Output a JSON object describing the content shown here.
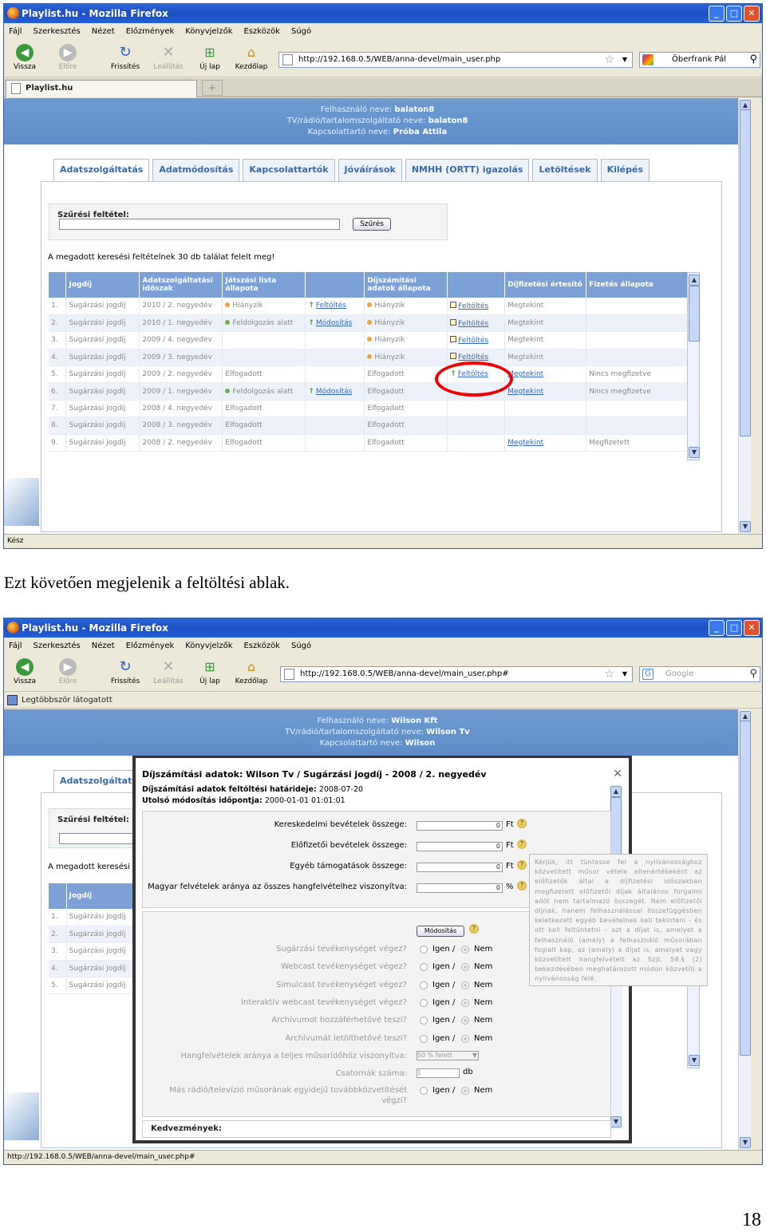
{
  "browser": {
    "window_title": "Playlist.hu - Mozilla Firefox",
    "menu": [
      "Fájl",
      "Szerkesztés",
      "Nézet",
      "Előzmények",
      "Könyvjelzők",
      "Eszközök",
      "Súgó"
    ],
    "toolbar": {
      "back": "Vissza",
      "forward": "Előre",
      "reload": "Frissítés",
      "stop": "Leállítás",
      "newtab": "Új lap",
      "home": "Kezdőlap"
    }
  },
  "shot1": {
    "url": "http://192.168.0.5/WEB/anna-devel/main_user.php",
    "search_value": "Öberfrank Pál",
    "tab_title": "Playlist.hu",
    "header": {
      "user_label": "Felhasználó neve:",
      "user": "balaton8",
      "provider_label": "TV/rádió/tartalomszolgáltató neve:",
      "provider": "balaton8",
      "contact_label": "Kapcsolattartó neve:",
      "contact": "Próba Attila"
    },
    "tabs": [
      "Adatszolgáltatás",
      "Adatmódosítás",
      "Kapcsolattartók",
      "Jóváírások",
      "NMHH (ORTT) igazolás",
      "Letöltések",
      "Kilépés"
    ],
    "filter_label": "Szűrési feltétel:",
    "filter_button": "Szűrés",
    "result_text": "A megadott keresési feltételnek 30 db találat felelt meg!",
    "columns": [
      "",
      "Jogdíj",
      "Adatszolgáltatási időszak",
      "Játszási lista állapota",
      "",
      "Díjszámítási adatok állapota",
      "",
      "Díjfizetési értesítő",
      "Fizetés állapota"
    ],
    "rows": [
      {
        "n": "1.",
        "fee": "Sugárzási jogdíj",
        "period": "2010 / 2. negyedév",
        "pl_state": "Hiányzik",
        "pl_dot": "o",
        "pl_action": "Feltöltés",
        "calc_state": "Hiányzik",
        "calc_dot": "o",
        "calc_action": "Feltöltés",
        "notice": "Megtekint",
        "notice_link": false,
        "pay": ""
      },
      {
        "n": "2.",
        "fee": "Sugárzási jogdíj",
        "period": "2010 / 1. negyedév",
        "pl_state": "Feldolgozás alatt",
        "pl_dot": "g",
        "pl_action": "Módosítás",
        "calc_state": "Hiányzik",
        "calc_dot": "o",
        "calc_action": "Feltöltés",
        "notice": "Megtekint",
        "notice_link": false,
        "pay": ""
      },
      {
        "n": "3.",
        "fee": "Sugárzási jogdíj",
        "period": "2009 / 4. negyedév",
        "pl_state": "",
        "pl_dot": "",
        "pl_action": "",
        "calc_state": "Hiányzik",
        "calc_dot": "o",
        "calc_action": "Feltöltés",
        "notice": "Megtekint",
        "notice_link": false,
        "pay": ""
      },
      {
        "n": "4.",
        "fee": "Sugárzási jogdíj",
        "period": "2009 / 3. negyedév",
        "pl_state": "",
        "pl_dot": "",
        "pl_action": "",
        "calc_state": "Hiányzik",
        "calc_dot": "o",
        "calc_action": "Feltöltés",
        "notice": "Megtekint",
        "notice_link": false,
        "pay": ""
      },
      {
        "n": "5.",
        "fee": "Sugárzási jogdíj",
        "period": "2009 / 2. negyedév",
        "pl_state": "Elfogadott",
        "pl_dot": "",
        "pl_action": "",
        "calc_state": "Elfogadott",
        "calc_dot": "",
        "calc_action": "Feltöltés",
        "notice": "Megtekint",
        "notice_link": true,
        "pay": "Nincs megfizetve"
      },
      {
        "n": "6.",
        "fee": "Sugárzási jogdíj",
        "period": "2009 / 1. negyedév",
        "pl_state": "Feldolgozás alatt",
        "pl_dot": "g",
        "pl_action": "Módosítás",
        "calc_state": "Elfogadott",
        "calc_dot": "",
        "calc_action": "",
        "notice": "Megtekint",
        "notice_link": true,
        "pay": "Nincs megfizetve"
      },
      {
        "n": "7.",
        "fee": "Sugárzási jogdíj",
        "period": "2008 / 4. negyedév",
        "pl_state": "Elfogadott",
        "pl_dot": "",
        "pl_action": "",
        "calc_state": "Elfogadott",
        "calc_dot": "",
        "calc_action": "",
        "notice": "",
        "notice_link": false,
        "pay": ""
      },
      {
        "n": "8.",
        "fee": "Sugárzási jogdíj",
        "period": "2008 / 3. negyedév",
        "pl_state": "Elfogadott",
        "pl_dot": "",
        "pl_action": "",
        "calc_state": "Elfogadott",
        "calc_dot": "",
        "calc_action": "",
        "notice": "",
        "notice_link": false,
        "pay": ""
      },
      {
        "n": "9.",
        "fee": "Sugárzási jogdíj",
        "period": "2008 / 2. negyedév",
        "pl_state": "Elfogadott",
        "pl_dot": "",
        "pl_action": "",
        "calc_state": "Elfogadott",
        "calc_dot": "",
        "calc_action": "",
        "notice": "Megtekint",
        "notice_link": true,
        "pay": "Megfizetett"
      }
    ],
    "status": "Kész"
  },
  "caption": "Ezt követően megjelenik a feltöltési ablak.",
  "shot2": {
    "url": "http://192.168.0.5/WEB/anna-devel/main_user.php#",
    "search_placeholder": "Google",
    "bookmark": "Legtöbbször látogatott",
    "header": {
      "user_label": "Felhasználó neve:",
      "user": "Wilson Kft",
      "provider_label": "TV/rádió/tartalomszolgáltató neve:",
      "provider": "Wilson Tv",
      "contact_label": "Kapcsolattartó neve:",
      "contact": "Wilson"
    },
    "bg_tab": "Adatszolgáltatás",
    "bg_filter_label": "Szűrési feltétel:",
    "bg_result": "A megadott keresési f",
    "bg_col": "Jogdíj",
    "bg_rows": [
      {
        "n": "1.",
        "fee": "Sugárzási jogdíj"
      },
      {
        "n": "2.",
        "fee": "Sugárzási jogdíj"
      },
      {
        "n": "3.",
        "fee": "Sugárzási jogdíj"
      },
      {
        "n": "4.",
        "fee": "Sugárzási jogdíj"
      },
      {
        "n": "5.",
        "fee": "Sugárzási jogdíj"
      }
    ],
    "modal": {
      "title": "Díjszámítási adatok: Wilson Tv / Sugárzási jogdíj - 2008 / 2. negyedév",
      "deadline_label": "Díjszámítási adatok feltöltési határideje:",
      "deadline": "2008-07-20",
      "modified_label": "Utolsó módosítás időpontja:",
      "modified": "2000-01-01 01:01:01",
      "fields": [
        {
          "label": "Kereskedelmi bevételek összege:",
          "value": "0",
          "unit": "Ft"
        },
        {
          "label": "Előfizetői bevételek összege:",
          "value": "0",
          "unit": "Ft"
        },
        {
          "label": "Egyéb támogatások összege:",
          "value": "0",
          "unit": "Ft"
        },
        {
          "label": "Magyar felvételek aránya az összes hangfelvételhez viszonyítva:",
          "value": "0",
          "unit": "%"
        }
      ],
      "modify_button": "Módosítás",
      "questions": [
        "Sugárzási tevékenységet végez?",
        "Webcast tevékenységet végez?",
        "Simulcast tevékenységet végez?",
        "Interaktív webcast tevékenységet végez?",
        "Archívumot hozzáférhetővé teszi?",
        "Archívumát letölthetővé teszi?"
      ],
      "yes": "Igen /",
      "no": "Nem",
      "ratio_label": "Hangfelvételek aránya a teljes műsoridőhöz viszonyítva:",
      "ratio_value": "50 % felett",
      "channels_label": "Csatornák száma:",
      "channels_value": "1",
      "channels_unit": "db",
      "other_label": "Más rádió/televízió műsorának egyidejű továbbközvetítését végzi?",
      "discounts_label": "Kedvezmények:",
      "tooltip": "Kérjük, itt tüntesse fel a nyilvánossághoz közvetített műsor vétele ellenértékeként az előfizetők által a díjfizetési időszakban megfizetett előfizetői díjak általános forgalmi adót nem tartalmazó összegét. Nem előfizetői díjnak, hanem felhasználással összefüggésben keletkezett egyéb bevételnek kell tekinteni - és ott kell feltüntetni - azt a díjat is, amelyet a felhasználó (amely) a felhasználó műsorában foglalt kap, az (amely) a díjat is, amelyet vagy közvetített hangfelvételt az Szjt. 58.§ (2) bekezdésében meghatározott módon közvetíti a nyilvánosság felé."
    },
    "status": "http://192.168.0.5/WEB/anna-devel/main_user.php#"
  },
  "page_number": "18"
}
